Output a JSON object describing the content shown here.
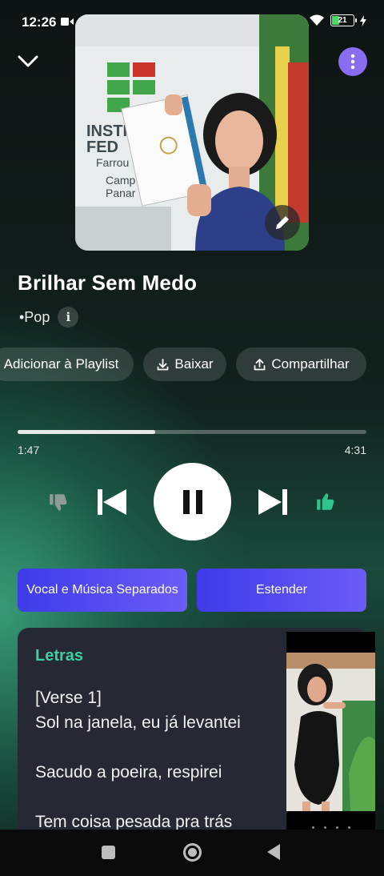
{
  "status_bar": {
    "time": "12:26",
    "battery": "21"
  },
  "song": {
    "title": "Brilhar Sem Medo",
    "genre": "•Pop",
    "info_glyph": "i"
  },
  "actions": {
    "playlist_label": "Adicionar à Playlist",
    "download_label": "Baixar",
    "share_label": "Compartilhar"
  },
  "progress": {
    "current": "1:47",
    "total": "4:31",
    "fraction": 0.395
  },
  "buttons": {
    "separate_label": "Vocal e Música Separados",
    "extend_label": "Estender"
  },
  "lyrics": {
    "title": "Letras",
    "lines": [
      "[Verse 1]",
      "Sol na janela, eu já levantei",
      "",
      "Sacudo a poeira, respirei",
      "",
      "Tem coisa pesada pra trás"
    ]
  },
  "colors": {
    "accent_green": "#3ed0a0",
    "button_purple": "#5a4cf2",
    "menu_purple": "#8a6cf0"
  },
  "icons": [
    "chevron-down-icon",
    "more-vertical-icon",
    "pencil-icon",
    "download-icon",
    "share-icon",
    "thumbs-down-icon",
    "skip-previous-icon",
    "pause-icon",
    "skip-next-icon",
    "thumbs-up-icon"
  ]
}
